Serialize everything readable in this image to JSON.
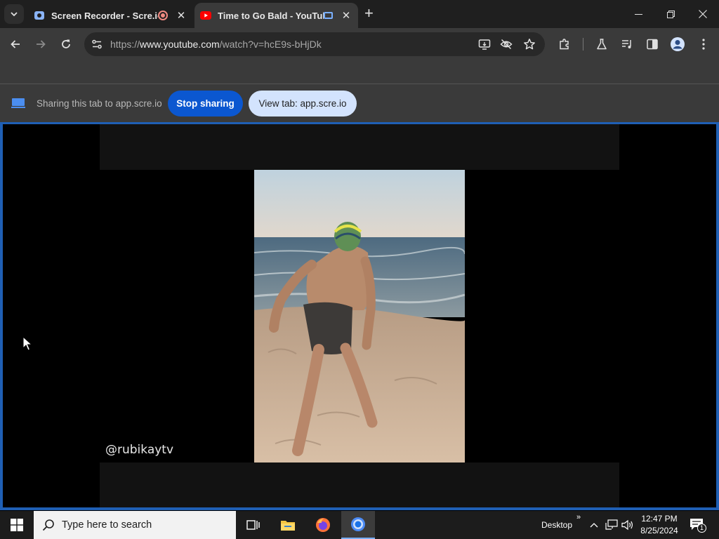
{
  "tabs": [
    {
      "title": "Screen Recorder - Scre.io",
      "active": false
    },
    {
      "title": "Time to Go Bald - YouTube",
      "active": true
    }
  ],
  "toolbar": {
    "url_prefix": "https://",
    "url_host": "www.youtube.com",
    "url_path": "/watch?v=hcE9s-bHjDk"
  },
  "sharebar": {
    "message": "Sharing this tab to app.scre.io",
    "stop_label": "Stop sharing",
    "view_label": "View tab: app.scre.io"
  },
  "video": {
    "watermark": "@rubikaytv"
  },
  "taskbar": {
    "search_placeholder": "Type here to search",
    "desktop_label": "Desktop",
    "time": "12:47 PM",
    "date": "8/25/2024",
    "notification_count": "1"
  },
  "colors": {
    "accent": "#0b57d0",
    "share_border": "#1f5fb4",
    "tab_bg": "#1f1f1f",
    "toolbar_bg": "#3a3a3a"
  },
  "icons": [
    "tab-search-icon",
    "screen-recorder-favicon",
    "recording-icon",
    "youtube-favicon",
    "casting-icon",
    "close-icon",
    "new-tab-icon",
    "minimize-icon",
    "restore-icon",
    "window-close-icon",
    "back-icon",
    "forward-icon",
    "reload-icon",
    "site-info-icon",
    "cast-screen-icon",
    "eye-off-icon",
    "star-icon",
    "extensions-icon",
    "labs-icon",
    "media-icon",
    "side-panel-icon",
    "profile-icon",
    "menu-icon",
    "share-tab-icon",
    "windows-start-icon",
    "search-icon",
    "task-view-icon",
    "file-explorer-icon",
    "firefox-icon",
    "chrome-icon",
    "chevron-up-icon",
    "network-icon",
    "volume-icon",
    "notification-icon"
  ]
}
